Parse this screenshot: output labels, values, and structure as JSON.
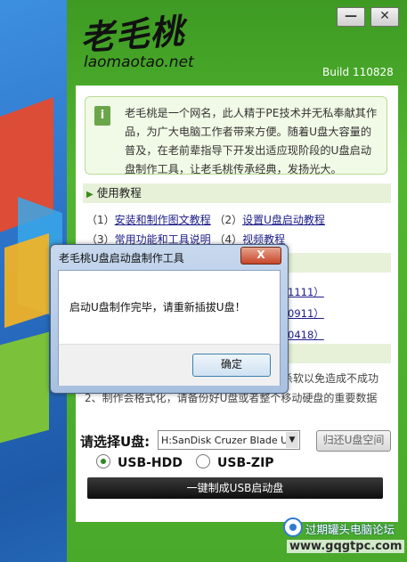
{
  "app": {
    "logo_cn": "老毛桃",
    "logo_en": "laomaotao.net",
    "build": "Build 110828",
    "minimize": "—",
    "close": "✕"
  },
  "info": {
    "icon": "i",
    "text": "老毛桃是一个网名，此人精于PE技术并无私奉献其作品，为广大电脑工作者带来方便。随着U盘大容量的普及，在老前辈指导下开发出适应现阶段的U盘启动盘制作工具，让老毛桃传承经典，发扬光大。"
  },
  "tutorial": {
    "heading": "使用教程",
    "row1_prefix": "（1）",
    "row1_link": "安装和制作图文教程",
    "row1_mid": "（2）",
    "row1_link2": "设置U盘启动教程",
    "row2_prefix": "（3）",
    "row2_link": "常用功能和工具说明",
    "row2_mid": "（4）",
    "row2_link2": "视频教程"
  },
  "fragments": [
    "1111）",
    "0911）",
    "0418）"
  ],
  "notes": {
    "line1": "杀软以免造成不成功",
    "line2": "2、制作会格式化，请备份好U盘或者整个移动硬盘的重要数据"
  },
  "controls": {
    "select_label": "请选择U盘:",
    "select_value": "H:SanDisk Cruzer Blade US",
    "restore_button": "归还U盘空间",
    "radio_hdd": "USB-HDD",
    "radio_zip": "USB-ZIP",
    "make_button": "一键制成USB启动盘"
  },
  "dialog": {
    "title": "老毛桃U盘启动盘制作工具",
    "close": "X",
    "message": "启动U盘制作完毕，请重新插拔U盘！",
    "ok": "确定"
  },
  "watermark": {
    "title": "过期罐头电脑论坛",
    "url": "www.gqgtpc.com"
  }
}
